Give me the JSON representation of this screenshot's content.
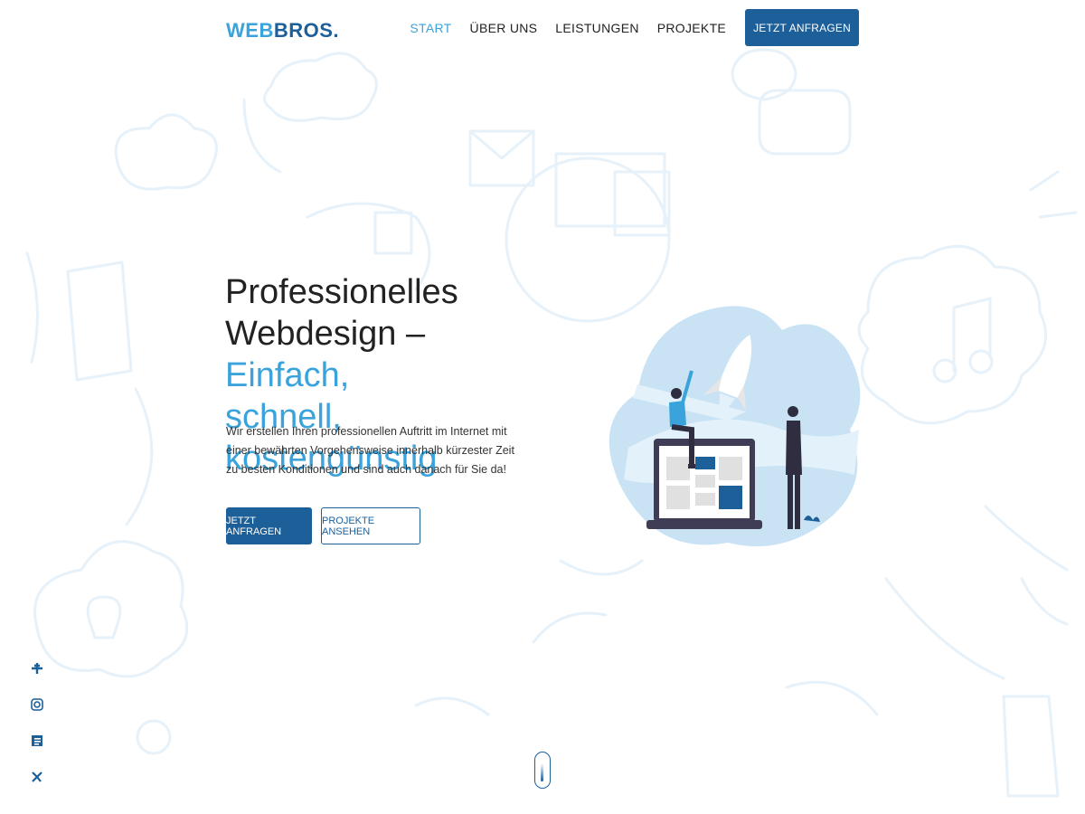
{
  "header": {
    "logo_part1": "WEB",
    "logo_part2": "BROS."
  },
  "nav": {
    "items": [
      {
        "label": "START",
        "active": true
      },
      {
        "label": "ÜBER UNS",
        "active": false
      },
      {
        "label": "LEISTUNGEN",
        "active": false
      },
      {
        "label": "PROJEKTE",
        "active": false
      }
    ],
    "cta_label": "JETZT ANFRAGEN"
  },
  "hero": {
    "title_line1": "Professionelles",
    "title_line2_plain": "Webdesign – ",
    "title_line2_highlight": "Einfach,",
    "title_line3_highlight": "schnell, kostengünstig",
    "description": "Wir erstellen Ihren professionellen Auftritt im Internet mit einer bewährten Vorgehensweise innerhalb kürzester Zeit zu besten Konditionen und sind auch danach für Sie da!",
    "primary_button": "JETZT ANFRAGEN",
    "secondary_button": "PROJEKTE ANSEHEN"
  },
  "social": {
    "icons": [
      "facebook-icon",
      "instagram-icon",
      "blog-icon",
      "xing-icon"
    ]
  },
  "colors": {
    "accent": "#3aa3db",
    "brand": "#1d5f99"
  }
}
